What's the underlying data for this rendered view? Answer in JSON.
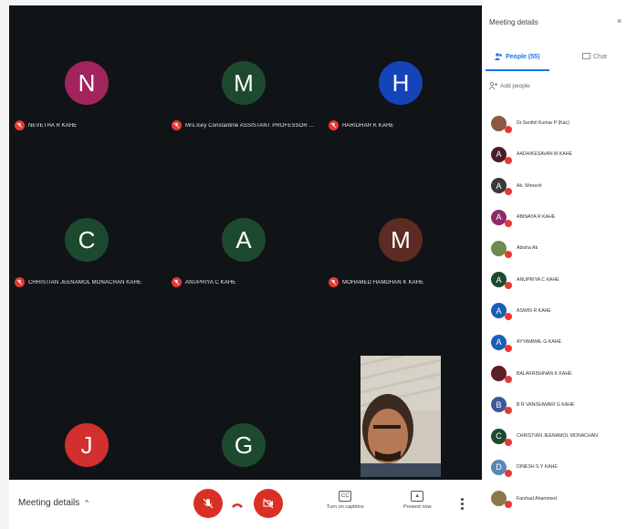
{
  "tiles": [
    {
      "initial": "N",
      "name": "NEVETHA R KAHE",
      "color": "#a1245d"
    },
    {
      "initial": "M",
      "name": "Mrs.Icey Constantine ASSISTANT PROFESSOR ...",
      "color": "#1d4a2e"
    },
    {
      "initial": "H",
      "name": "HARIDHAR K KAHE",
      "color": "#1544b8"
    },
    {
      "initial": "C",
      "name": "CHRISTIAN JEENAMOL MONACHAN KAHE",
      "color": "#1d4a2e"
    },
    {
      "initial": "A",
      "name": "ANUPRIYA C KAHE",
      "color": "#1d4a2e"
    },
    {
      "initial": "M",
      "name": "MOHAMED HAMDHAN K KAHE",
      "color": "#5e2b24"
    },
    {
      "initial": "J",
      "name": "",
      "color": "#d32f2f"
    },
    {
      "initial": "G",
      "name": "",
      "color": "#1d4a2e"
    }
  ],
  "bottom_bar": {
    "meeting_details": "Meeting details",
    "chevron": "^",
    "captions_label": "Turn on captions",
    "present_label": "Present now"
  },
  "panel": {
    "title": "Meeting details",
    "close": "×",
    "people_tab": "People (55)",
    "chat_tab": "Chat",
    "add_people": "Add people",
    "people": [
      {
        "initial": "",
        "name": "Dr.Senthil Kumar P (Kac)",
        "color": "#8a5a44"
      },
      {
        "initial": "A",
        "name": "AADHIKESAVAN M KAHE",
        "color": "#4a1c2c"
      },
      {
        "initial": "A",
        "name": "Ab. Monesh",
        "color": "#3a3a3a"
      },
      {
        "initial": "A",
        "name": "ABINAYA R KAHE",
        "color": "#8e2a6a"
      },
      {
        "initial": "",
        "name": "Abisha Ab",
        "color": "#6f8a4a"
      },
      {
        "initial": "A",
        "name": "ANUPRIYA C KAHE",
        "color": "#1d4a2e"
      },
      {
        "initial": "A",
        "name": "ASWIN R KAHE",
        "color": "#1a5fb4"
      },
      {
        "initial": "A",
        "name": "AYYAMMAL G KAHE",
        "color": "#1a5fb4"
      },
      {
        "initial": "",
        "name": "BALAKRISHNAN K KAHE",
        "color": "#5a1e24"
      },
      {
        "initial": "B",
        "name": "B R VANISHWARI G KAHE",
        "color": "#3b5998"
      },
      {
        "initial": "C",
        "name": "CHRISTIAN JEENAMOL MONACHAN",
        "color": "#1d4a2e"
      },
      {
        "initial": "D",
        "name": "DINESH S Y KAHE",
        "color": "#5a86b8"
      },
      {
        "initial": "",
        "name": "Farshad Ahammed",
        "color": "#8a7a4a"
      }
    ]
  },
  "colors": {
    "stage": "#111416",
    "mic_off": "#e53935",
    "end_call": "#d93025",
    "accent": "#1a73e8"
  },
  "icons": [
    "mic-off-icon",
    "hang-up-icon",
    "camera-off-icon",
    "captions-icon",
    "present-icon",
    "more-vert-icon",
    "people-icon",
    "chat-icon",
    "add-person-icon",
    "close-icon"
  ]
}
